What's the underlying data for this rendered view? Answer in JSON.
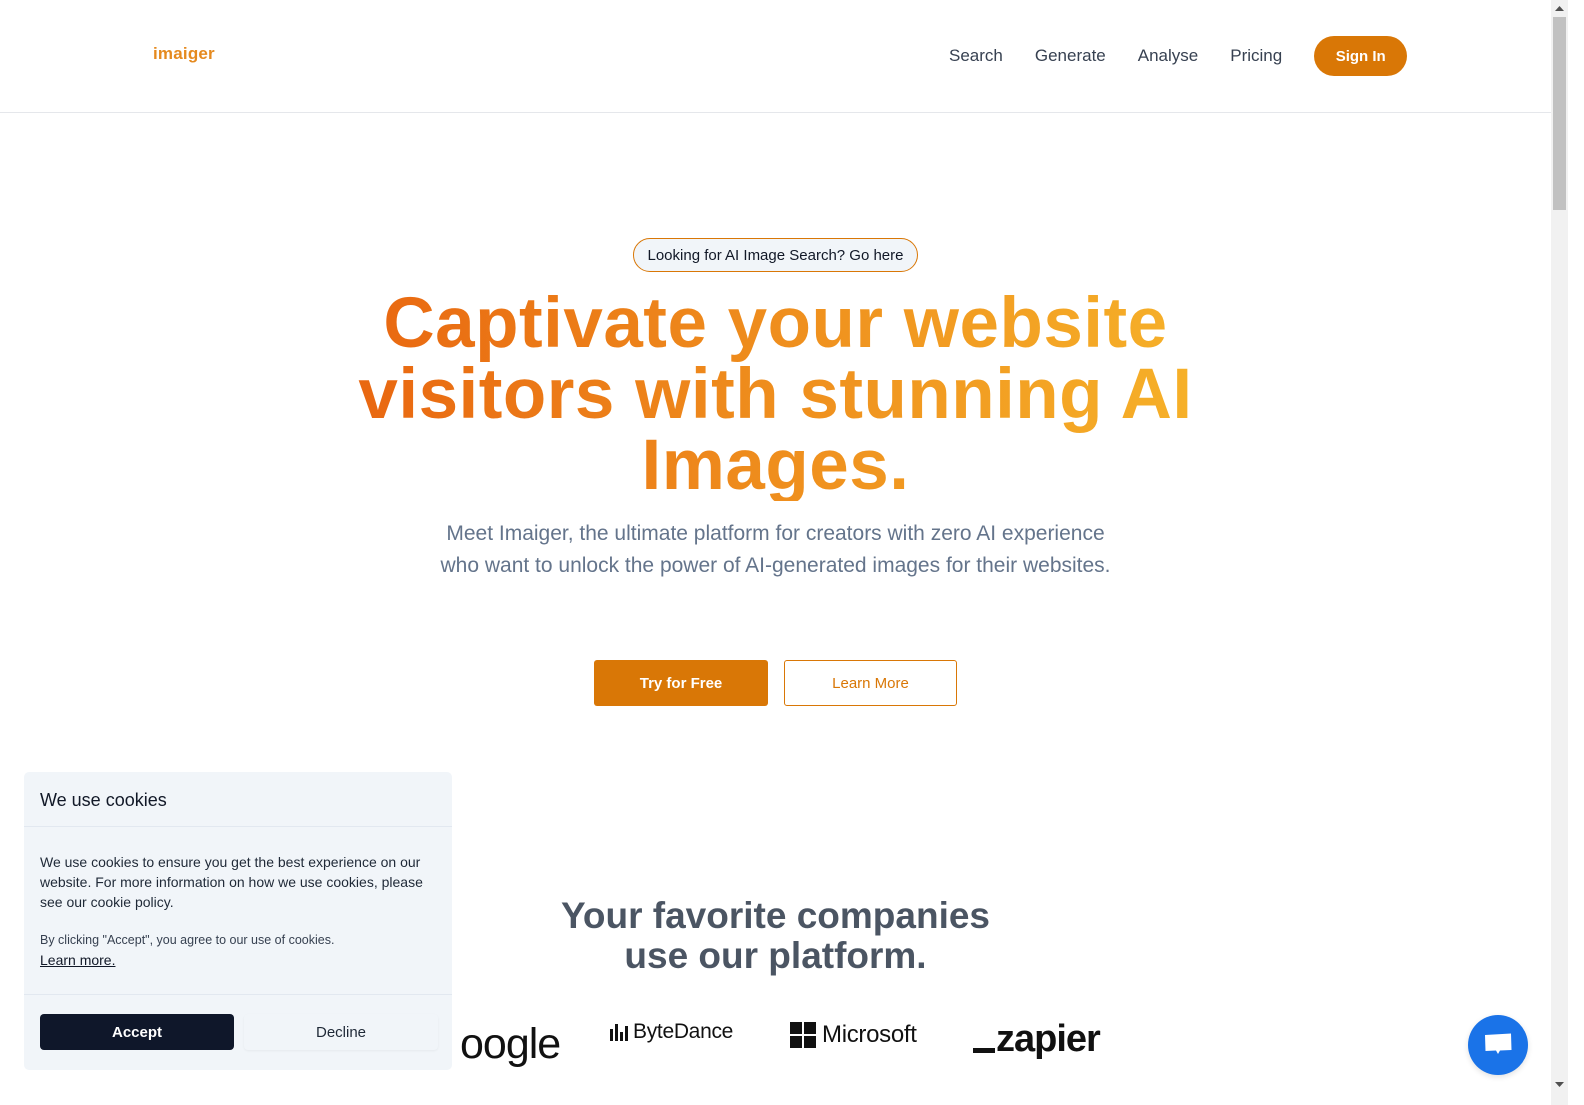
{
  "header": {
    "logo": "imaiger",
    "nav": [
      {
        "label": "Search"
      },
      {
        "label": "Generate"
      },
      {
        "label": "Analyse"
      },
      {
        "label": "Pricing"
      }
    ],
    "sign_in": "Sign In"
  },
  "hero": {
    "pill": "Looking for AI Image Search? Go here",
    "headline_lines": [
      "Captivate your website",
      "visitors with stunning AI",
      "Images."
    ],
    "subtitle": "Meet Imaiger, the ultimate platform for creators with zero AI experience who want to unlock the power of AI-generated images for their websites.",
    "primary_button": "Try for Free",
    "secondary_button": "Learn More"
  },
  "companies": {
    "title_lines": [
      "Your favorite companies",
      "use our platform."
    ],
    "logos": [
      {
        "name": "Google",
        "text": "oogle",
        "icon": "google-logo"
      },
      {
        "name": "ByteDance",
        "text": "ByteDance",
        "icon": "bytedance-bars-icon"
      },
      {
        "name": "Microsoft",
        "text": "Microsoft",
        "icon": "microsoft-grid-icon"
      },
      {
        "name": "Zapier",
        "text": "zapier",
        "icon": "zapier-underscore-icon"
      }
    ]
  },
  "cookie_banner": {
    "title": "We use cookies",
    "body": "We use cookies to ensure you get the best experience on our website. For more information on how we use cookies, please see our cookie policy.",
    "note": "By clicking \"Accept\", you agree to our use of cookies.",
    "learn_more": "Learn more.",
    "accept": "Accept",
    "decline": "Decline"
  },
  "chat_widget": {
    "icon": "chat-bubble-icon"
  },
  "colors": {
    "brand": "#d97706",
    "gradient_start": "#e8620f",
    "gradient_end": "#f7b52a",
    "chat": "#1a73e8",
    "accept_bg": "#0f172a"
  }
}
